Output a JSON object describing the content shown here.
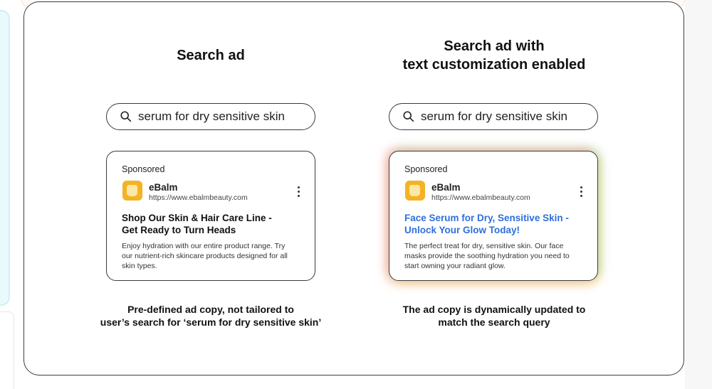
{
  "left": {
    "title": "Search ad",
    "search_query": "serum for dry sensitive skin",
    "ad": {
      "sponsored": "Sponsored",
      "brand": "eBalm",
      "url": "https://www.ebalmbeauty.com",
      "headline_lines": [
        "Shop Our Skin & Hair Care Line -",
        "Get Ready to Turn Heads"
      ],
      "description_lines": [
        "Enjoy hydration with our entire product range. Try",
        "our nutrient-rich skincare products designed for all",
        "skin types."
      ]
    },
    "caption_lines": [
      "Pre-defined ad copy, not tailored to",
      "user’s search for ‘serum for dry sensitive skin’"
    ]
  },
  "right": {
    "title_lines": [
      "Search ad with",
      "text customization enabled"
    ],
    "search_query": "serum for dry sensitive skin",
    "ad": {
      "sponsored": "Sponsored",
      "brand": "eBalm",
      "url": "https://www.ebalmbeauty.com",
      "headline_lines": [
        "Face Serum for Dry, Sensitive Skin -",
        "Unlock Your Glow Today!"
      ],
      "description_lines": [
        "The perfect treat for dry, sensitive skin. Our face",
        "masks provide the soothing hydration you need to",
        "start owning your radiant glow."
      ]
    },
    "caption_lines": [
      "The ad copy is dynamically updated to",
      "match the search query"
    ]
  },
  "icons": {
    "search": "search-icon",
    "more": "more-vert-icon",
    "logo": "ebalm-logo"
  },
  "colors": {
    "accent_blue": "#2f6fdc",
    "logo_yellow": "#f4b324",
    "border": "#3a3a3a"
  }
}
